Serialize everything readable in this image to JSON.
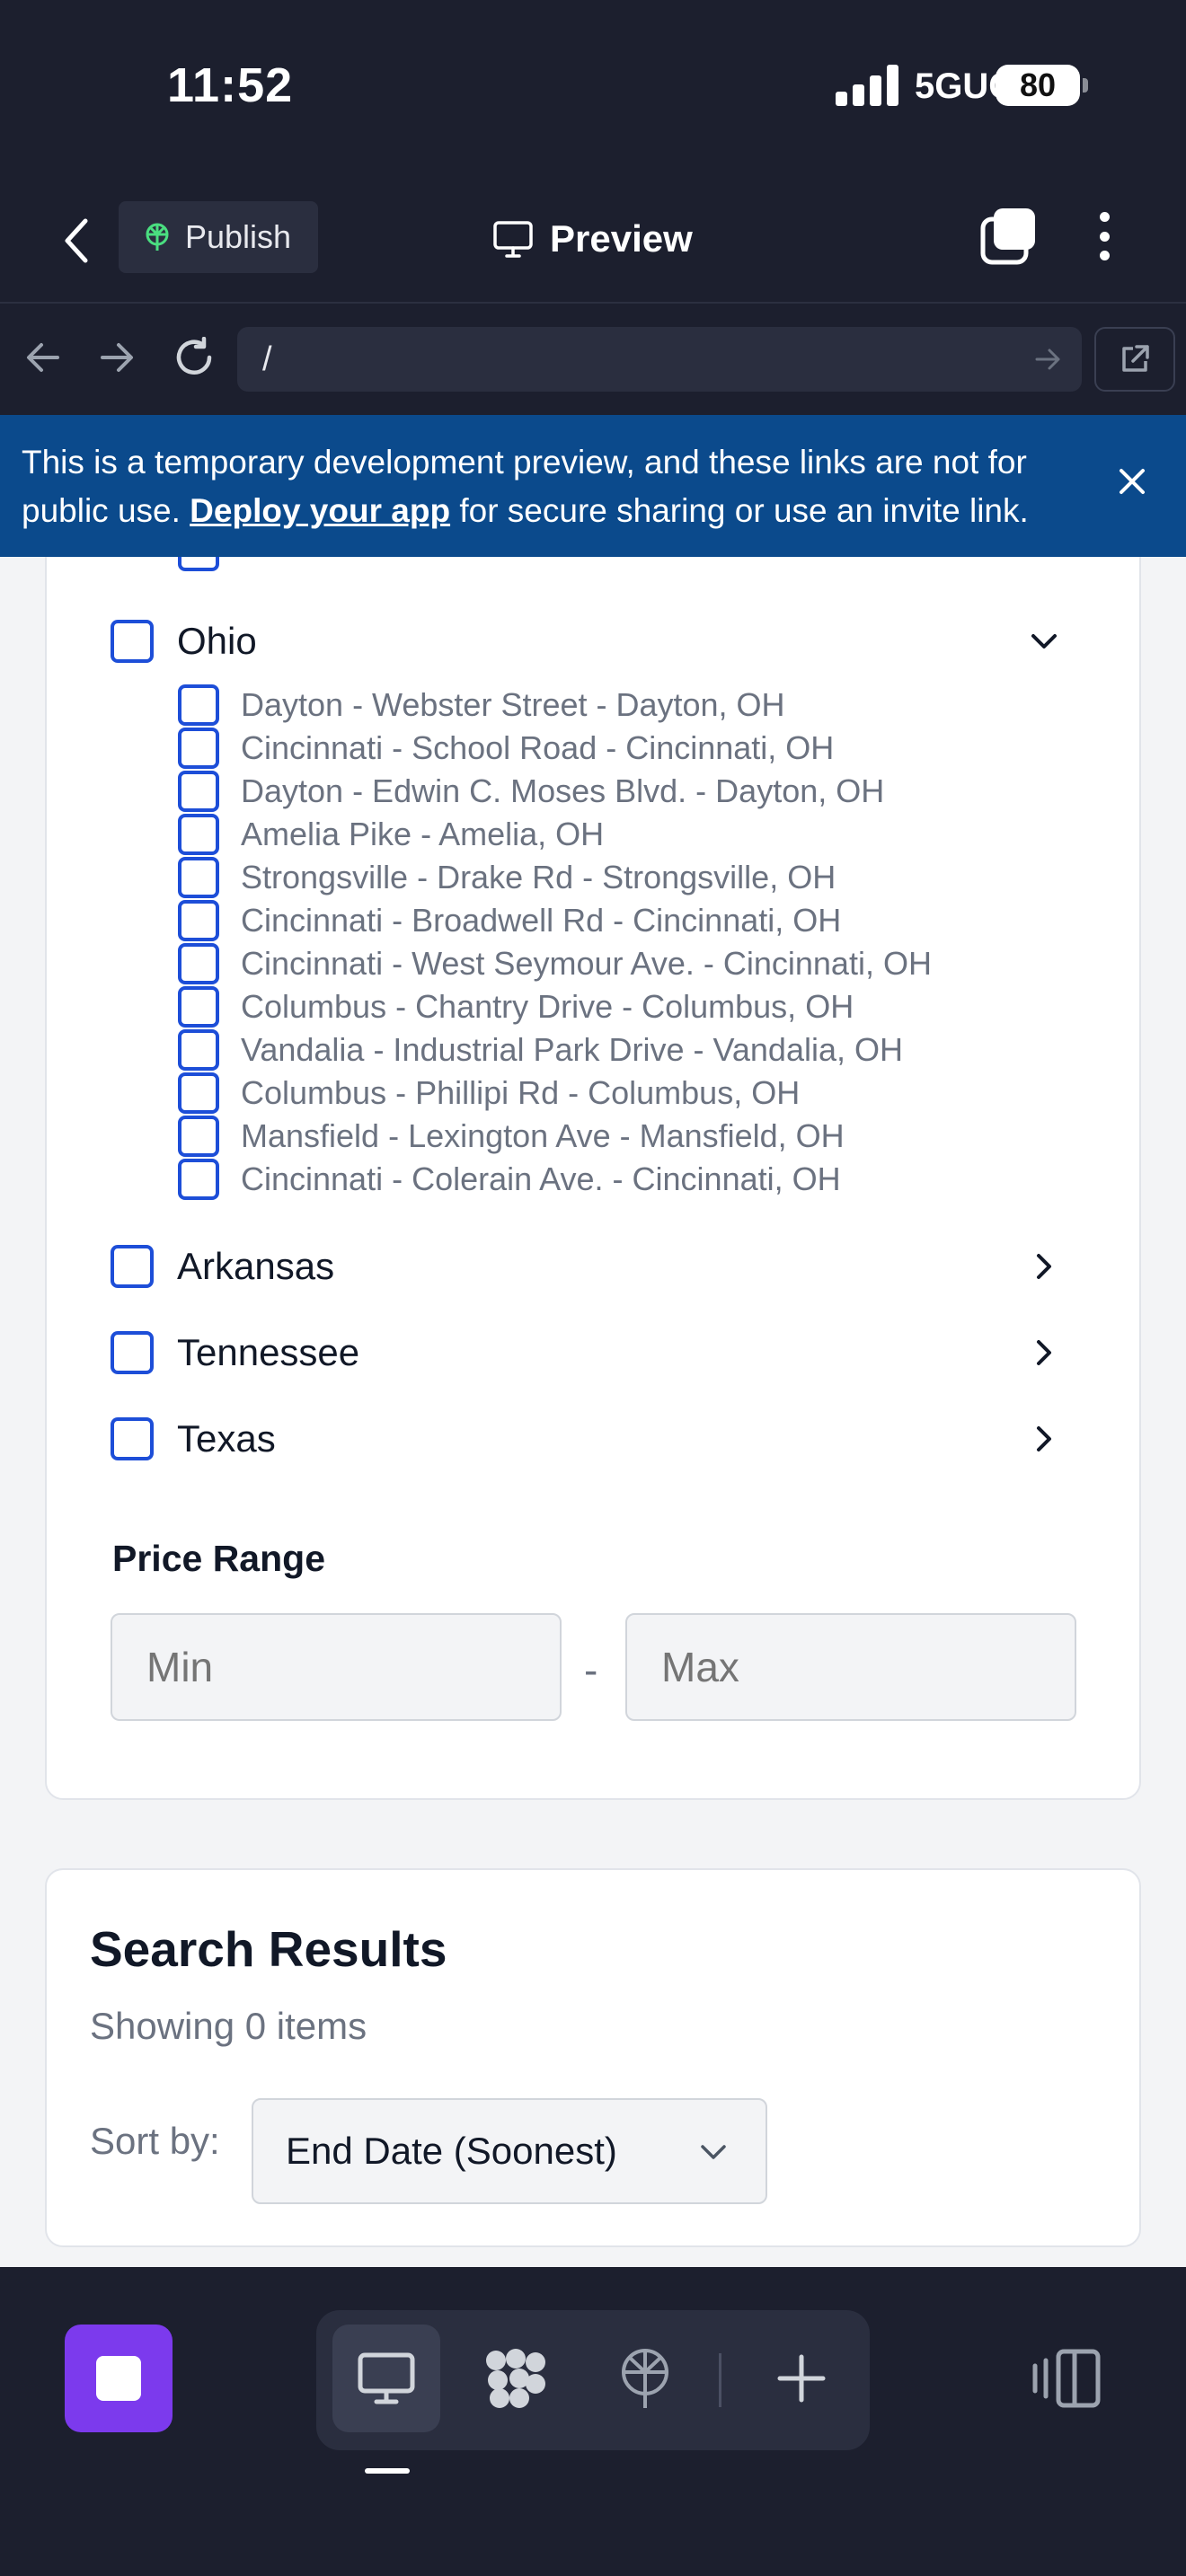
{
  "status": {
    "time": "11:52",
    "network": "5GUC",
    "battery": "80"
  },
  "header": {
    "publish_label": "Publish",
    "preview_label": "Preview"
  },
  "browser": {
    "url": "/"
  },
  "banner": {
    "text_before": "This is a temporary development preview, and these links are not for public use. ",
    "link": "Deploy your app",
    "text_after": " for secure sharing or use an invite link."
  },
  "filters": {
    "expanded_state": {
      "label": "Ohio",
      "locations": [
        "Dayton - Webster Street - Dayton, OH",
        "Cincinnati - School Road - Cincinnati, OH",
        "Dayton - Edwin C. Moses Blvd. - Dayton, OH",
        "Amelia Pike - Amelia, OH",
        "Strongsville - Drake Rd - Strongsville, OH",
        "Cincinnati - Broadwell Rd - Cincinnati, OH",
        "Cincinnati - West Seymour Ave. - Cincinnati, OH",
        "Columbus - Chantry Drive - Columbus, OH",
        "Vandalia - Industrial Park Drive - Vandalia, OH",
        "Columbus - Phillipi Rd - Columbus, OH",
        "Mansfield - Lexington Ave - Mansfield, OH",
        "Cincinnati - Colerain Ave. - Cincinnati, OH"
      ]
    },
    "collapsed_states": [
      "Arkansas",
      "Tennessee",
      "Texas"
    ],
    "price": {
      "title": "Price Range",
      "min_placeholder": "Min",
      "max_placeholder": "Max",
      "separator": "-"
    }
  },
  "results": {
    "title": "Search Results",
    "count_text": "Showing 0 items",
    "sort_label": "Sort by:",
    "sort_value": "End Date (Soonest)"
  },
  "colors": {
    "accent": "#1d4ed8",
    "banner": "#0b4a8c",
    "stop": "#7c3aed",
    "chrome": "#1c1f2e"
  }
}
